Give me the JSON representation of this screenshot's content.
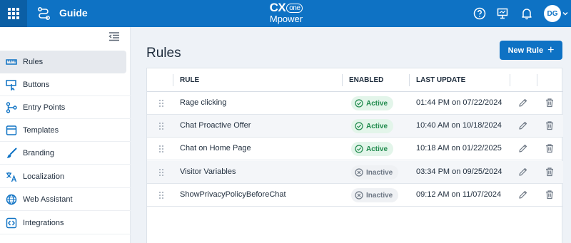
{
  "topbar": {
    "app_title": "Guide",
    "brand_cx": "CX",
    "brand_one": "one",
    "brand_mpower": "Mpower",
    "avatar_initials": "DG"
  },
  "sidebar": {
    "items": [
      {
        "label": "Rules",
        "icon": "rules-icon",
        "active": true
      },
      {
        "label": "Buttons",
        "icon": "button-icon"
      },
      {
        "label": "Entry Points",
        "icon": "entry-points-icon"
      },
      {
        "label": "Templates",
        "icon": "templates-icon"
      },
      {
        "label": "Branding",
        "icon": "brush-icon"
      },
      {
        "label": "Localization",
        "icon": "translate-icon"
      },
      {
        "label": "Web Assistant",
        "icon": "globe-icon"
      },
      {
        "label": "Integrations",
        "icon": "integrations-icon"
      }
    ]
  },
  "main": {
    "title": "Rules",
    "new_rule_label": "New Rule",
    "columns": {
      "rule": "RULE",
      "enabled": "ENABLED",
      "last_update": "LAST UPDATE"
    },
    "rows": [
      {
        "name": "Rage clicking",
        "status": "Active",
        "updated": "01:44 PM on 07/22/2024"
      },
      {
        "name": "Chat Proactive Offer",
        "status": "Active",
        "updated": "10:40 AM on 10/18/2024"
      },
      {
        "name": "Chat on Home Page",
        "status": "Active",
        "updated": "10:18 AM on 01/22/2025"
      },
      {
        "name": "Visitor Variables",
        "status": "Inactive",
        "updated": "03:34 PM on 09/25/2024"
      },
      {
        "name": "ShowPrivacyPolicyBeforeChat",
        "status": "Inactive",
        "updated": "09:12 AM on 11/07/2024"
      }
    ]
  },
  "colors": {
    "topbar": "#0e72c4",
    "active_badge_text": "#1f8a4c",
    "inactive_badge_text": "#6d7784"
  }
}
